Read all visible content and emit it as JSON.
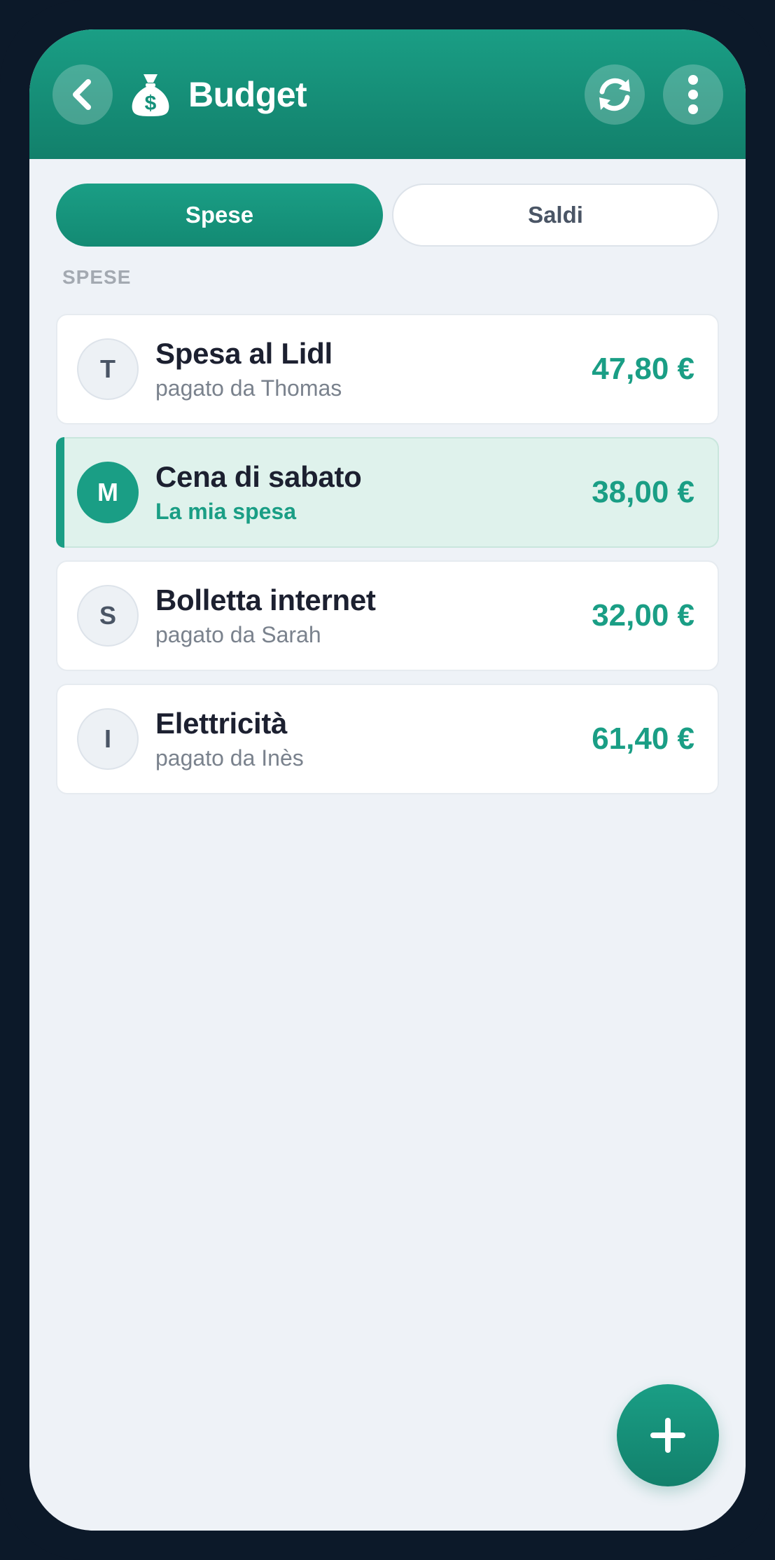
{
  "header": {
    "title": "Budget",
    "back_icon": "chevron-left-icon",
    "app_icon": "money-bag-icon",
    "refresh_icon": "refresh-icon",
    "menu_icon": "more-vertical-icon"
  },
  "tabs": [
    {
      "label": "Spese",
      "active": true
    },
    {
      "label": "Saldi",
      "active": false
    }
  ],
  "section_label": "SPESE",
  "expenses": [
    {
      "initial": "T",
      "title": "Spesa al Lidl",
      "subtitle": "pagato da Thomas",
      "amount": "47,80 €",
      "mine": false
    },
    {
      "initial": "M",
      "title": "Cena di sabato",
      "subtitle": "La mia spesa",
      "amount": "38,00 €",
      "mine": true
    },
    {
      "initial": "S",
      "title": "Bolletta internet",
      "subtitle": "pagato da Sarah",
      "amount": "32,00 €",
      "mine": false
    },
    {
      "initial": "I",
      "title": "Elettricità",
      "subtitle": "pagato da Inès",
      "amount": "61,40 €",
      "mine": false
    }
  ],
  "fab": {
    "icon": "plus-icon"
  },
  "colors": {
    "accent": "#1a9e85",
    "accent_dark": "#12806b",
    "background": "#eef2f7",
    "highlight": "#dff2ec"
  }
}
